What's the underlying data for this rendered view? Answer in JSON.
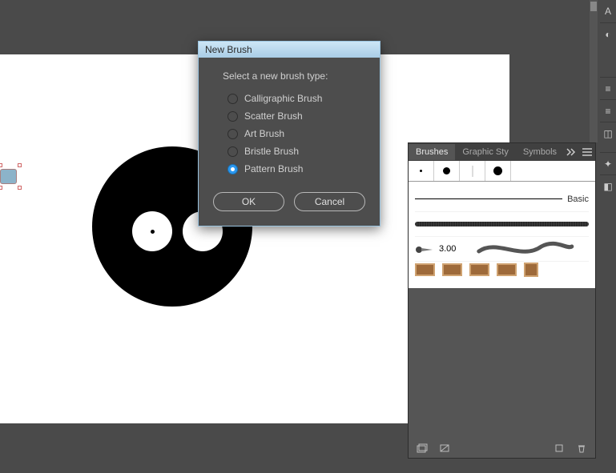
{
  "dialog": {
    "title": "New Brush",
    "prompt": "Select a new brush type:",
    "options": [
      {
        "label": "Calligraphic Brush",
        "checked": false
      },
      {
        "label": "Scatter Brush",
        "checked": false
      },
      {
        "label": "Art Brush",
        "checked": false
      },
      {
        "label": "Bristle Brush",
        "checked": false
      },
      {
        "label": "Pattern Brush",
        "checked": true
      }
    ],
    "ok_label": "OK",
    "cancel_label": "Cancel"
  },
  "panel": {
    "tabs": [
      "Brushes",
      "Graphic Sty",
      "Symbols"
    ],
    "active_tab": 0,
    "brushes": {
      "basic_label": "Basic",
      "stroke_size": "3.00"
    }
  }
}
